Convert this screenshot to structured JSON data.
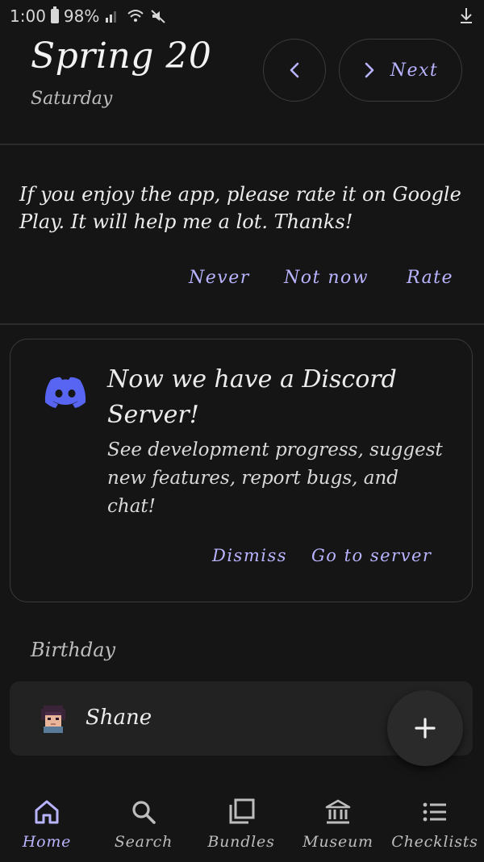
{
  "status_bar": {
    "time": "1:00",
    "battery": "98%"
  },
  "header": {
    "date_title": "Spring 20",
    "day_subtitle": "Saturday",
    "next_label": "Next"
  },
  "rating_prompt": {
    "text": "If you enjoy the app, please rate it on Google Play. It will help me a lot. Thanks!",
    "never_label": "Never",
    "not_now_label": "Not now",
    "rate_label": "Rate"
  },
  "discord_card": {
    "title": "Now we have a Discord Server!",
    "body": "See development progress, suggest new features, report bugs, and chat!",
    "dismiss_label": "Dismiss",
    "go_label": "Go to server"
  },
  "birthday": {
    "section_label": "Birthday",
    "villager_name": "Shane"
  },
  "bottom_nav": {
    "items": [
      {
        "label": "Home",
        "icon": "home-icon",
        "active": true
      },
      {
        "label": "Search",
        "icon": "search-icon",
        "active": false
      },
      {
        "label": "Bundles",
        "icon": "bundles-icon",
        "active": false
      },
      {
        "label": "Museum",
        "icon": "museum-icon",
        "active": false
      },
      {
        "label": "Checklists",
        "icon": "checklist-icon",
        "active": false
      }
    ]
  },
  "colors": {
    "background": "#151515",
    "accent": "#b9b4ff",
    "discord_blurple": "#5865f2"
  }
}
